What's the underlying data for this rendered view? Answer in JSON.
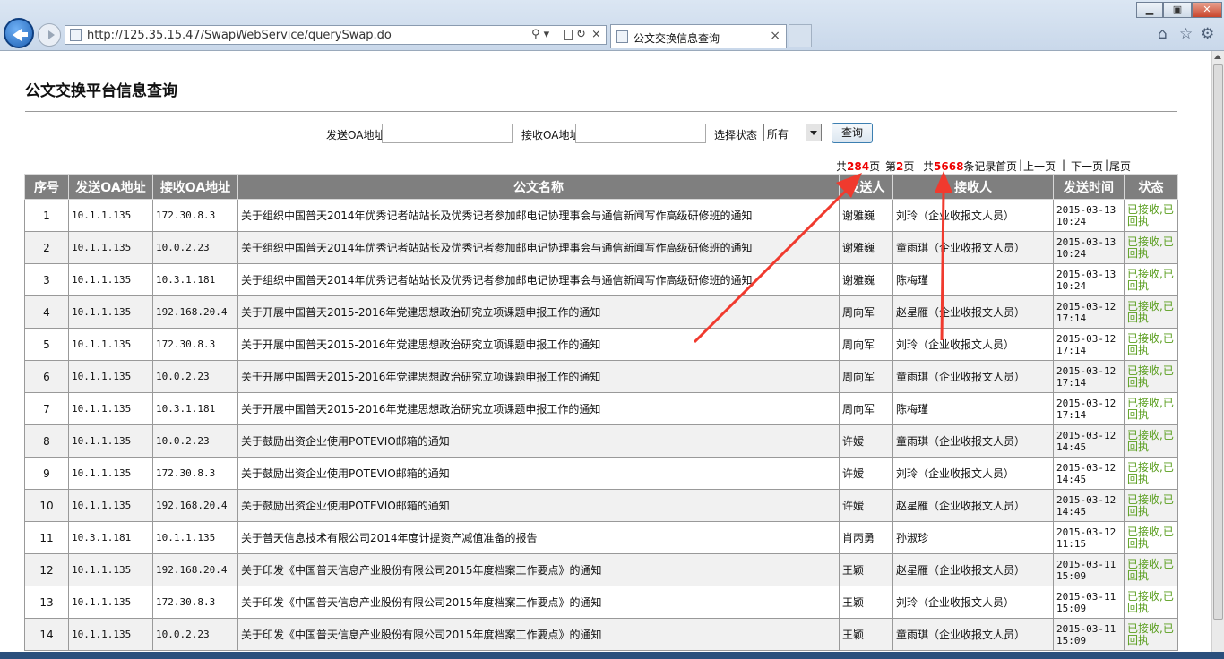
{
  "browser": {
    "url": "http://125.35.15.47/SwapWebService/querySwap.do",
    "tab_title": "公文交换信息查询",
    "tab_close": "×",
    "search_glyph": "⚲ ▾",
    "refresh_glyph": "↻",
    "stop_glyph": "×",
    "win_min": "▁",
    "win_max": "▣",
    "win_close": "✕",
    "home_icon": "⌂",
    "star_icon": "☆",
    "gear_icon": "⚙"
  },
  "page": {
    "title": "公文交换平台信息查询"
  },
  "search": {
    "send_label": "发送OA地址",
    "send_value": "",
    "recv_label": "接收OA地址",
    "recv_value": "",
    "status_label": "选择状态",
    "status_value": "所有",
    "query_button": "查询"
  },
  "pager": {
    "total_pages_prefix": "共",
    "total_pages": "284",
    "total_pages_suffix": "页",
    "current_prefix": "第",
    "current_page": "2",
    "current_suffix": "页",
    "total_records_prefix": "共",
    "total_records": "5668",
    "total_records_suffix": "条记录",
    "first": "首页",
    "sep1": "|",
    "prev": "上一页",
    "sep2": "|",
    "next": "下一页",
    "sep3": "|",
    "last": "尾页"
  },
  "table": {
    "headers": [
      "序号",
      "发送OA地址",
      "接收OA地址",
      "公文名称",
      "发送人",
      "接收人",
      "发送时间",
      "状态"
    ],
    "rows": [
      {
        "no": "1",
        "send": "10.1.1.135",
        "recv": "172.30.8.3",
        "name": "关于组织中国普天2014年优秀记者站站长及优秀记者参加邮电记协理事会与通信新闻写作高级研修班的通知",
        "sender": "谢雅巍",
        "receiver": "刘玲（企业收报文人员）",
        "time": "2015-03-13 10:24",
        "status": "已接收,已回执"
      },
      {
        "no": "2",
        "send": "10.1.1.135",
        "recv": "10.0.2.23",
        "name": "关于组织中国普天2014年优秀记者站站长及优秀记者参加邮电记协理事会与通信新闻写作高级研修班的通知",
        "sender": "谢雅巍",
        "receiver": "童雨琪（企业收报文人员）",
        "time": "2015-03-13 10:24",
        "status": "已接收,已回执"
      },
      {
        "no": "3",
        "send": "10.1.1.135",
        "recv": "10.3.1.181",
        "name": "关于组织中国普天2014年优秀记者站站长及优秀记者参加邮电记协理事会与通信新闻写作高级研修班的通知",
        "sender": "谢雅巍",
        "receiver": "陈梅瑾",
        "time": "2015-03-13 10:24",
        "status": "已接收,已回执"
      },
      {
        "no": "4",
        "send": "10.1.1.135",
        "recv": "192.168.20.4",
        "name": "关于开展中国普天2015-2016年党建思想政治研究立项课题申报工作的通知",
        "sender": "周向军",
        "receiver": "赵星雁（企业收报文人员）",
        "time": "2015-03-12 17:14",
        "status": "已接收,已回执"
      },
      {
        "no": "5",
        "send": "10.1.1.135",
        "recv": "172.30.8.3",
        "name": "关于开展中国普天2015-2016年党建思想政治研究立项课题申报工作的通知",
        "sender": "周向军",
        "receiver": "刘玲（企业收报文人员）",
        "time": "2015-03-12 17:14",
        "status": "已接收,已回执"
      },
      {
        "no": "6",
        "send": "10.1.1.135",
        "recv": "10.0.2.23",
        "name": "关于开展中国普天2015-2016年党建思想政治研究立项课题申报工作的通知",
        "sender": "周向军",
        "receiver": "童雨琪（企业收报文人员）",
        "time": "2015-03-12 17:14",
        "status": "已接收,已回执"
      },
      {
        "no": "7",
        "send": "10.1.1.135",
        "recv": "10.3.1.181",
        "name": "关于开展中国普天2015-2016年党建思想政治研究立项课题申报工作的通知",
        "sender": "周向军",
        "receiver": "陈梅瑾",
        "time": "2015-03-12 17:14",
        "status": "已接收,已回执"
      },
      {
        "no": "8",
        "send": "10.1.1.135",
        "recv": "10.0.2.23",
        "name": "关于鼓励出资企业使用POTEVIO邮箱的通知",
        "sender": "许嫒",
        "receiver": "童雨琪（企业收报文人员）",
        "time": "2015-03-12 14:45",
        "status": "已接收,已回执"
      },
      {
        "no": "9",
        "send": "10.1.1.135",
        "recv": "172.30.8.3",
        "name": "关于鼓励出资企业使用POTEVIO邮箱的通知",
        "sender": "许嫒",
        "receiver": "刘玲（企业收报文人员）",
        "time": "2015-03-12 14:45",
        "status": "已接收,已回执"
      },
      {
        "no": "10",
        "send": "10.1.1.135",
        "recv": "192.168.20.4",
        "name": "关于鼓励出资企业使用POTEVIO邮箱的通知",
        "sender": "许嫒",
        "receiver": "赵星雁（企业收报文人员）",
        "time": "2015-03-12 14:45",
        "status": "已接收,已回执"
      },
      {
        "no": "11",
        "send": "10.3.1.181",
        "recv": "10.1.1.135",
        "name": "关于普天信息技术有限公司2014年度计提资产减值准备的报告",
        "sender": "肖丙勇",
        "receiver": "孙淑珍",
        "time": "2015-03-12 11:15",
        "status": "已接收,已回执"
      },
      {
        "no": "12",
        "send": "10.1.1.135",
        "recv": "192.168.20.4",
        "name": "关于印发《中国普天信息产业股份有限公司2015年度档案工作要点》的通知",
        "sender": "王颖",
        "receiver": "赵星雁（企业收报文人员）",
        "time": "2015-03-11 15:09",
        "status": "已接收,已回执"
      },
      {
        "no": "13",
        "send": "10.1.1.135",
        "recv": "172.30.8.3",
        "name": "关于印发《中国普天信息产业股份有限公司2015年度档案工作要点》的通知",
        "sender": "王颖",
        "receiver": "刘玲（企业收报文人员）",
        "time": "2015-03-11 15:09",
        "status": "已接收,已回执"
      },
      {
        "no": "14",
        "send": "10.1.1.135",
        "recv": "10.0.2.23",
        "name": "关于印发《中国普天信息产业股份有限公司2015年度档案工作要点》的通知",
        "sender": "王颖",
        "receiver": "童雨琪（企业收报文人员）",
        "time": "2015-03-11 15:09",
        "status": "已接收,已回执"
      }
    ]
  },
  "colors": {
    "header_bg": "#7f7f7f",
    "status_text": "#5a9e1f",
    "pager_red": "#e00000",
    "annotation_arrow": "#f03a2e"
  }
}
